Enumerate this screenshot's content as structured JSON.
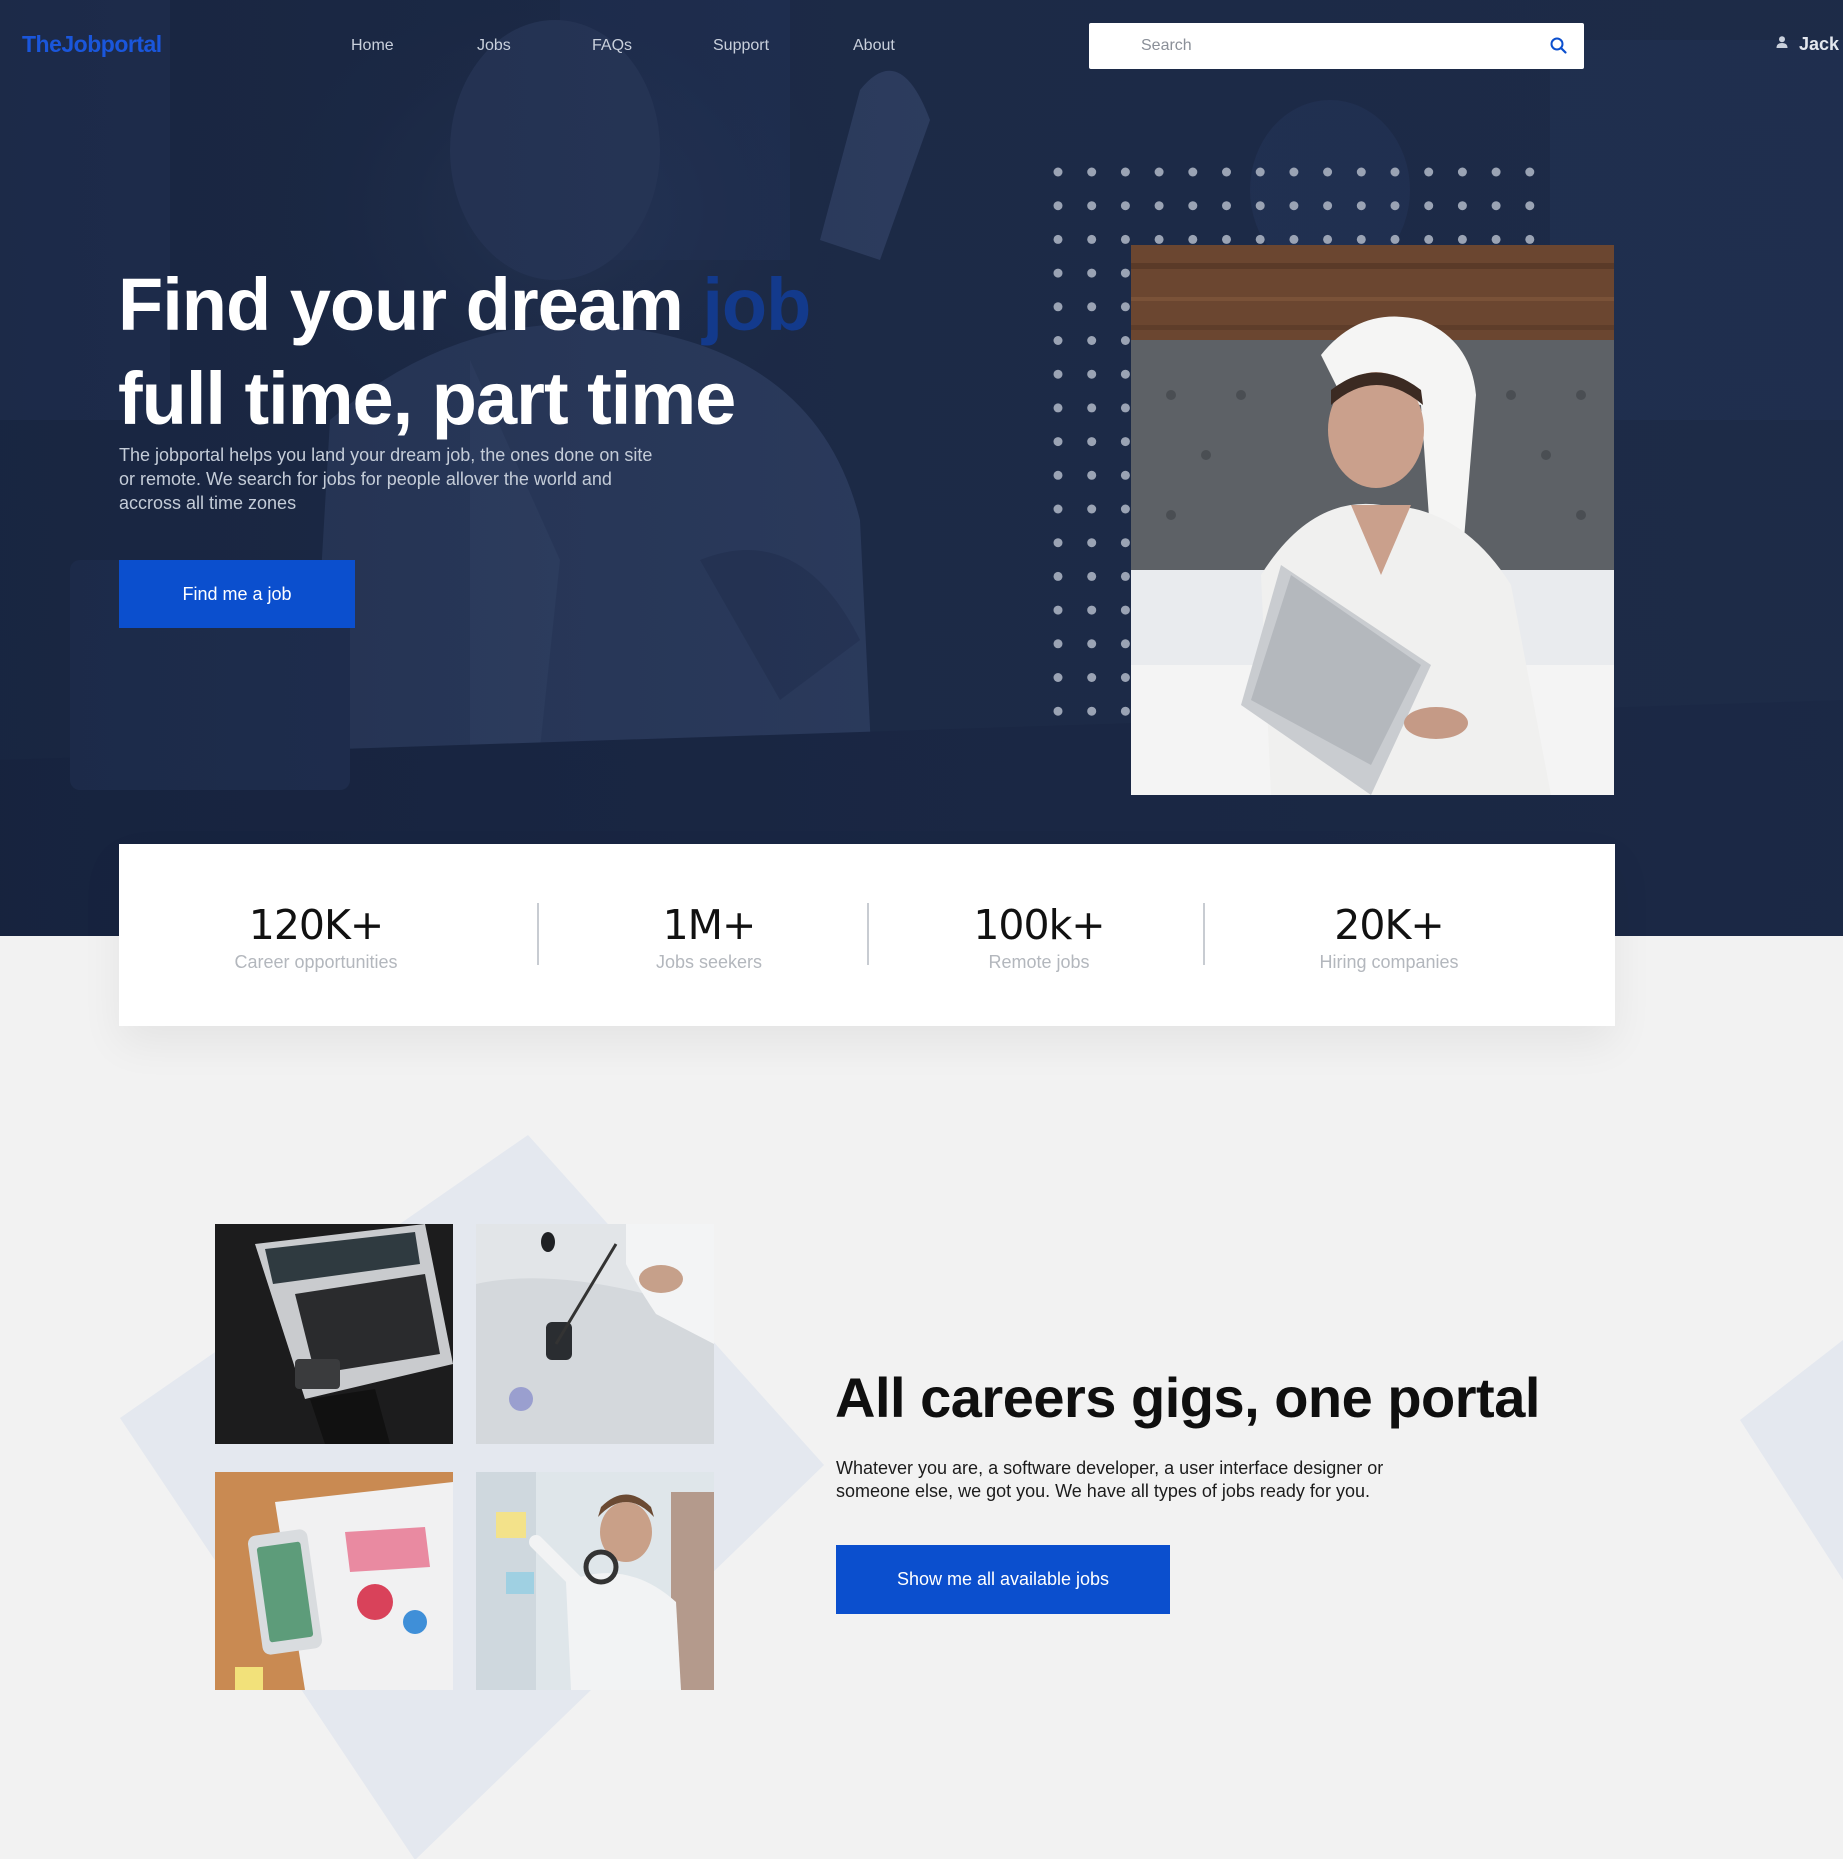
{
  "brand": {
    "logo": "TheJobportal",
    "accent_color": "#0b4fce",
    "hero_bg_color": "#1d2b47"
  },
  "nav": {
    "items": [
      {
        "label": "Home"
      },
      {
        "label": "Jobs"
      },
      {
        "label": "FAQs"
      },
      {
        "label": "Support"
      },
      {
        "label": "About"
      }
    ],
    "search": {
      "placeholder": "Search",
      "icon": "search-icon"
    },
    "user": {
      "name": "Jack",
      "icon": "user-icon"
    }
  },
  "hero": {
    "title_line1": "Find your dream ",
    "title_accent": "job",
    "title_line2": "full time, part time",
    "description": "The jobportal helps you land your dream job, the ones done on site or remote. We search for jobs for people allover the world and accross all time zones",
    "cta": "Find me a job"
  },
  "stats": [
    {
      "value": "120K+",
      "label": "Career opportunities"
    },
    {
      "value": "1M+",
      "label": "Jobs seekers"
    },
    {
      "value": "100k+",
      "label": "Remote jobs"
    },
    {
      "value": "20K+",
      "label": "Hiring companies"
    }
  ],
  "careers": {
    "title": "All careers gigs, one portal",
    "description": "Whatever you are, a software developer, a user interface designer or someone else, we got you. We have all types of jobs ready for you.",
    "cta": "Show me all available jobs"
  }
}
